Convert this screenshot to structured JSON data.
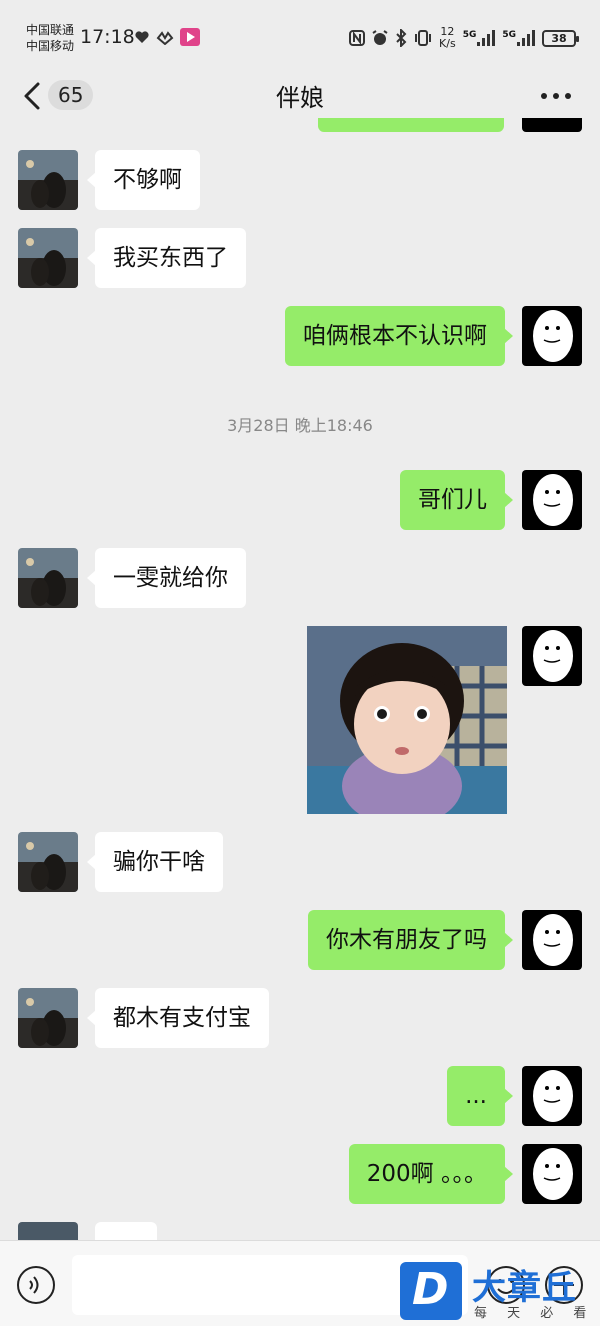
{
  "statusbar": {
    "carrier1": "中国联通",
    "carrier2": "中国移动",
    "time": "17:18",
    "netspeed_value": "12",
    "netspeed_unit": "K/s",
    "sig1": "5G",
    "sig2": "5G",
    "battery": "38"
  },
  "nav": {
    "unread": "65",
    "title": "伴娘"
  },
  "messages": {
    "m1": "不够啊",
    "m2": "我买东西了",
    "m3": "咱俩根本不认识啊",
    "ts": "3月28日 晚上18:46",
    "m4": "哥们儿",
    "m5": "一雯就给你",
    "m6": "骗你干啥",
    "m7": "你木有朋友了吗",
    "m8": "都木有支付宝",
    "m9": "...",
    "m10": "200啊 。。。"
  },
  "watermark": {
    "letter": "D",
    "text": "大章丘",
    "sub": "每 天 必 看"
  },
  "colors": {
    "background": "#ededed",
    "outgoing_bubble": "#95ec69",
    "incoming_bubble": "#ffffff",
    "watermark": "#1f6fd6"
  }
}
